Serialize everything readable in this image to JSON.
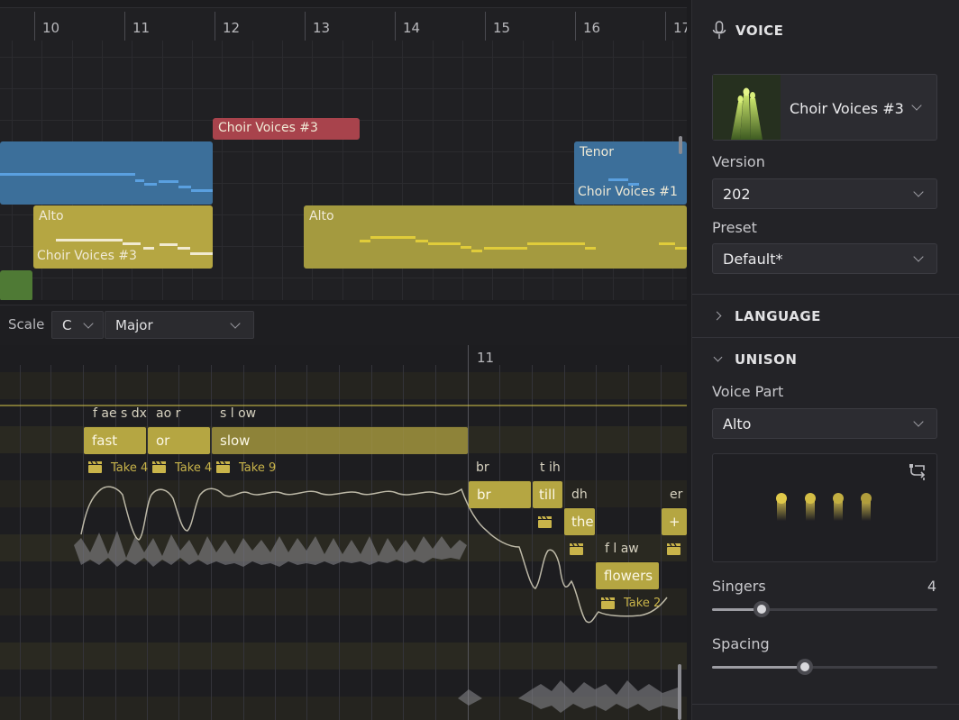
{
  "arrangement": {
    "bar_numbers": [
      "10",
      "11",
      "12",
      "13",
      "14",
      "15",
      "16",
      "17"
    ],
    "clips": [
      {
        "id": "soprano-clip",
        "label": "",
        "color": "#3c6f9a"
      },
      {
        "id": "choir3-red-clip",
        "label": "Choir Voices #3",
        "color": "#a8434c"
      },
      {
        "id": "tenor-clip",
        "label": "Tenor",
        "sublabel": "Choir Voices #1",
        "color": "#3c6f9a"
      },
      {
        "id": "alto-clip-1",
        "label": "Alto",
        "sublabel": "Choir Voices #3",
        "color": "#b5a642"
      },
      {
        "id": "alto-clip-2",
        "label": "Alto",
        "color": "#b5a642"
      },
      {
        "id": "green-clip",
        "label": "",
        "color": "#4f7a35"
      }
    ]
  },
  "roll": {
    "scale_label": "Scale",
    "key": "C",
    "mode": "Major",
    "bar_number": "11",
    "notes": [
      {
        "lyric": "fast",
        "phonemes": "f ae s dx",
        "take": "Take 4"
      },
      {
        "lyric": "or",
        "phonemes": "ao r",
        "take": "Take 4"
      },
      {
        "lyric": "slow",
        "phonemes": "s l ow",
        "take": "Take 9"
      },
      {
        "lyric": "br",
        "phonemes": "br",
        "take": ""
      },
      {
        "lyric": "till",
        "phonemes": "t ih",
        "take": ""
      },
      {
        "lyric": "the",
        "phonemes": "dh",
        "take": ""
      },
      {
        "lyric": "flowers",
        "phonemes": "f l aw",
        "take": "Take 2"
      },
      {
        "lyric": "+",
        "phonemes": "er",
        "take": ""
      }
    ]
  },
  "panel": {
    "section_voice": "VOICE",
    "voice_name": "Choir Voices #3",
    "version_label": "Version",
    "version_value": "202",
    "preset_label": "Preset",
    "preset_value": "Default*",
    "section_language": "LANGUAGE",
    "section_unison": "UNISON",
    "voice_part_label": "Voice Part",
    "voice_part_value": "Alto",
    "singers_label": "Singers",
    "singers_value": "4",
    "singers_fraction": 0.22,
    "spacing_label": "Spacing",
    "spacing_fraction": 0.41
  },
  "colors": {
    "accent_yellow": "#b5a642",
    "blue_clip": "#3c6f9a",
    "red_clip": "#a8434c",
    "green_clip": "#4f7a35"
  },
  "icons": [
    "microphone-icon",
    "chevron-down-icon",
    "chevron-right-icon",
    "randomize-icon",
    "take-clapper-icon",
    "singer-dot-icon"
  ]
}
